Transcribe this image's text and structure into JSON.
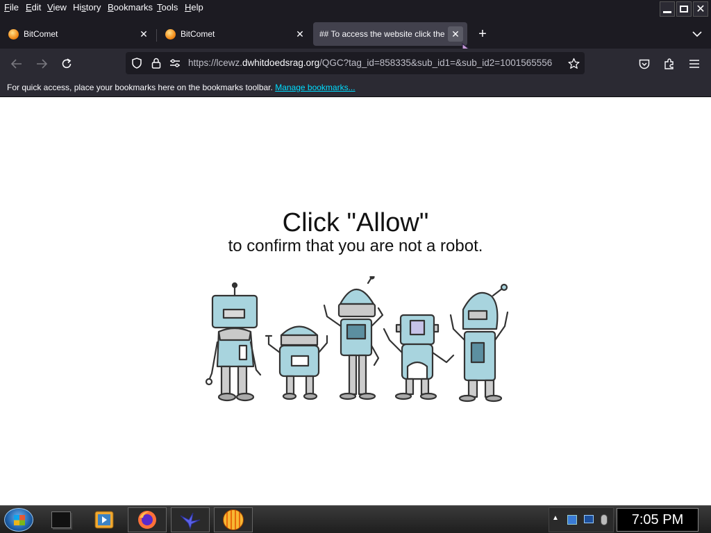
{
  "menubar": {
    "items": [
      "File",
      "Edit",
      "View",
      "History",
      "Bookmarks",
      "Tools",
      "Help"
    ],
    "mnemonic": [
      "F",
      "E",
      "V",
      "s",
      "B",
      "T",
      "H"
    ]
  },
  "tabs": [
    {
      "label": "BitComet",
      "icon": "bitcomet-favicon",
      "active": false
    },
    {
      "label": "BitComet",
      "icon": "bitcomet-favicon",
      "active": false
    },
    {
      "label": "## To access the website click the",
      "icon": "none",
      "active": true
    }
  ],
  "tabstrip": {
    "new_tab": "+",
    "list_all_tabs": "chevron-down-icon"
  },
  "navbar": {
    "url_prefix": "https://lcewz.",
    "url_domain": "dwhitdoedsrag.org",
    "url_rest": "/QGC?tag_id=858335&sub_id1=&sub_id2=1001565556"
  },
  "bookmarks": {
    "text": "For quick access, place your bookmarks here on the bookmarks toolbar.",
    "link": "Manage bookmarks..."
  },
  "content": {
    "headline": "Click \"Allow\"",
    "subline": "to confirm that you are not a robot."
  },
  "taskbar": {
    "clock": "7:05 PM",
    "apps": [
      "start-orb",
      "terminal",
      "media-player",
      "firefox",
      "bird-app",
      "bitcomet"
    ]
  },
  "colors": {
    "chrome_dark": "#1c1b22",
    "toolbar": "#2b2a33",
    "active_tab": "#42414d",
    "link": "#00ddff",
    "robot_fill": "#a8d4de"
  }
}
